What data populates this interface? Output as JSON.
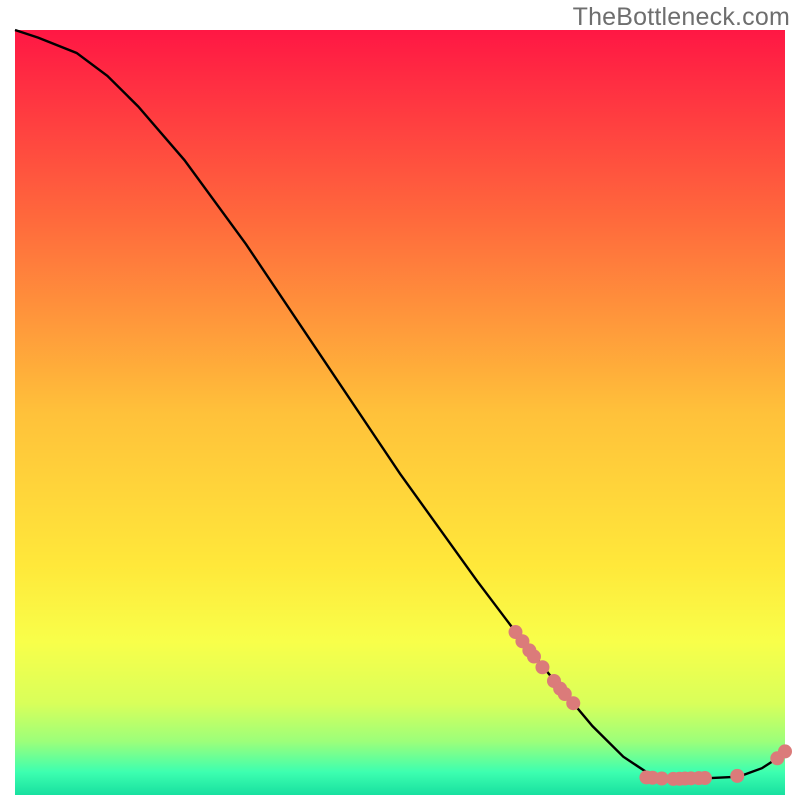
{
  "watermark": "TheBottleneck.com",
  "chart_data": {
    "type": "line",
    "title": "",
    "xlabel": "",
    "ylabel": "",
    "xlim": [
      0,
      100
    ],
    "ylim": [
      0,
      100
    ],
    "legend": null,
    "grid": false,
    "gradient_stops": [
      {
        "offset": 0.0,
        "color": "#ff1744"
      },
      {
        "offset": 0.25,
        "color": "#ff6a3c"
      },
      {
        "offset": 0.5,
        "color": "#ffc13a"
      },
      {
        "offset": 0.7,
        "color": "#ffe83a"
      },
      {
        "offset": 0.8,
        "color": "#f8ff4a"
      },
      {
        "offset": 0.88,
        "color": "#d9ff5a"
      },
      {
        "offset": 0.93,
        "color": "#9cff7a"
      },
      {
        "offset": 0.97,
        "color": "#3dffb0"
      },
      {
        "offset": 1.0,
        "color": "#18e0a0"
      }
    ],
    "curve": [
      {
        "x": 0,
        "y": 100
      },
      {
        "x": 3,
        "y": 99
      },
      {
        "x": 8,
        "y": 97
      },
      {
        "x": 12,
        "y": 94
      },
      {
        "x": 16,
        "y": 90
      },
      {
        "x": 22,
        "y": 83
      },
      {
        "x": 30,
        "y": 72
      },
      {
        "x": 40,
        "y": 57
      },
      {
        "x": 50,
        "y": 42
      },
      {
        "x": 60,
        "y": 28
      },
      {
        "x": 66,
        "y": 20
      },
      {
        "x": 70,
        "y": 15
      },
      {
        "x": 75,
        "y": 9
      },
      {
        "x": 79,
        "y": 5
      },
      {
        "x": 82,
        "y": 3
      },
      {
        "x": 85,
        "y": 2.2
      },
      {
        "x": 90,
        "y": 2.2
      },
      {
        "x": 94,
        "y": 2.4
      },
      {
        "x": 97,
        "y": 3.5
      },
      {
        "x": 99,
        "y": 4.8
      },
      {
        "x": 100,
        "y": 5.5
      }
    ],
    "markers": {
      "color": "#db7b7a",
      "radius": 7,
      "points": [
        {
          "x": 65,
          "y": 21.3
        },
        {
          "x": 65.9,
          "y": 20.1
        },
        {
          "x": 66.8,
          "y": 18.9
        },
        {
          "x": 67.4,
          "y": 18.1
        },
        {
          "x": 68.5,
          "y": 16.7
        },
        {
          "x": 70,
          "y": 14.9
        },
        {
          "x": 70.8,
          "y": 13.9
        },
        {
          "x": 71.4,
          "y": 13.2
        },
        {
          "x": 72.5,
          "y": 12
        },
        {
          "x": 82,
          "y": 2.3
        },
        {
          "x": 82.8,
          "y": 2.25
        },
        {
          "x": 84,
          "y": 2.15
        },
        {
          "x": 85.5,
          "y": 2.1
        },
        {
          "x": 86.3,
          "y": 2.12
        },
        {
          "x": 87,
          "y": 2.15
        },
        {
          "x": 87.8,
          "y": 2.18
        },
        {
          "x": 88.8,
          "y": 2.2
        },
        {
          "x": 89.6,
          "y": 2.22
        },
        {
          "x": 93.8,
          "y": 2.5
        },
        {
          "x": 99,
          "y": 4.8
        },
        {
          "x": 100,
          "y": 5.7
        }
      ]
    }
  }
}
